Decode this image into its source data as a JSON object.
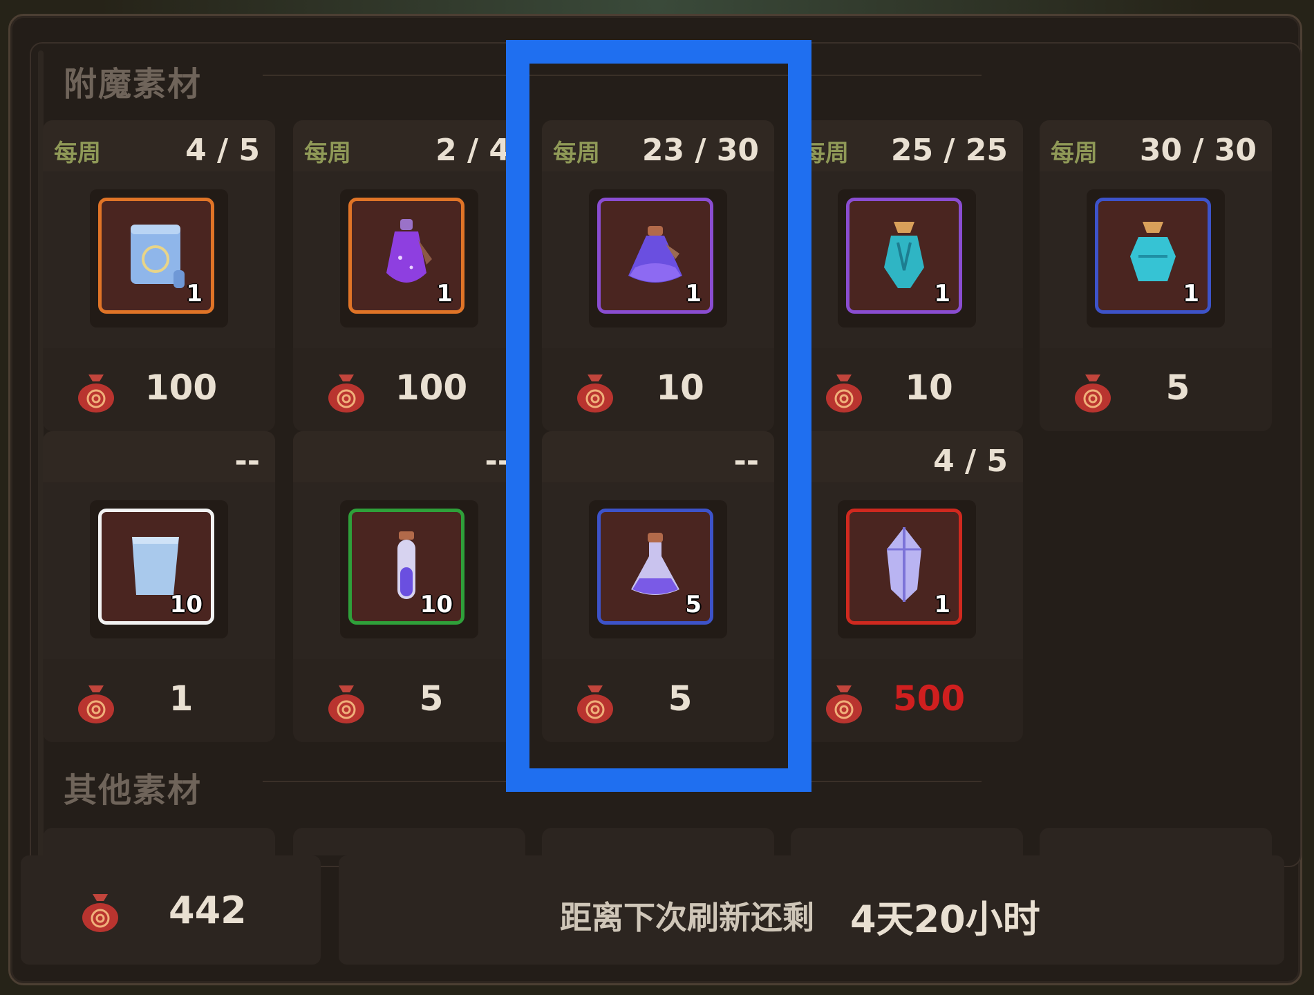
{
  "sections": {
    "enchant_title": "附魔素材",
    "other_title": "其他素材"
  },
  "row1": [
    {
      "tag": "每周",
      "count": "4 / 5",
      "qty": "1",
      "price": "100",
      "icon": "scroll-icon",
      "rarity_color": "#e07427"
    },
    {
      "tag": "每周",
      "count": "2 / 4",
      "qty": "1",
      "price": "100",
      "icon": "purple-potion-icon",
      "rarity_color": "#e07427"
    },
    {
      "tag": "每周",
      "count": "23 / 30",
      "qty": "1",
      "price": "10",
      "icon": "violet-flask-icon",
      "rarity_color": "#8a4dd1"
    },
    {
      "tag": "每周",
      "count": "25 / 25",
      "qty": "1",
      "price": "10",
      "icon": "teal-vial-icon",
      "rarity_color": "#8a4dd1"
    },
    {
      "tag": "每周",
      "count": "30 / 30",
      "qty": "1",
      "price": "5",
      "icon": "cyan-bottle-icon",
      "rarity_color": "#3d53c9"
    }
  ],
  "row2": [
    {
      "tag": "",
      "count": "--",
      "qty": "10",
      "price": "1",
      "icon": "paper-scroll-icon",
      "rarity_color": "#f2f2f2"
    },
    {
      "tag": "",
      "count": "--",
      "qty": "10",
      "price": "5",
      "icon": "test-tube-icon",
      "rarity_color": "#2fa03a"
    },
    {
      "tag": "",
      "count": "--",
      "qty": "5",
      "price": "5",
      "icon": "small-flask-icon",
      "rarity_color": "#3d53c9"
    },
    {
      "tag": "",
      "count": "4 / 5",
      "qty": "1",
      "price": "500",
      "icon": "crystal-icon",
      "rarity_color": "#d0291f",
      "price_red": true
    }
  ],
  "footer": {
    "currency_amount": "442",
    "refresh_label": "距离下次刷新还剩",
    "refresh_time": "4天20小时"
  },
  "colors": {
    "highlight": "#1f6ff0",
    "price_red": "#d01f1f",
    "weekly_tag": "#8f9957"
  }
}
